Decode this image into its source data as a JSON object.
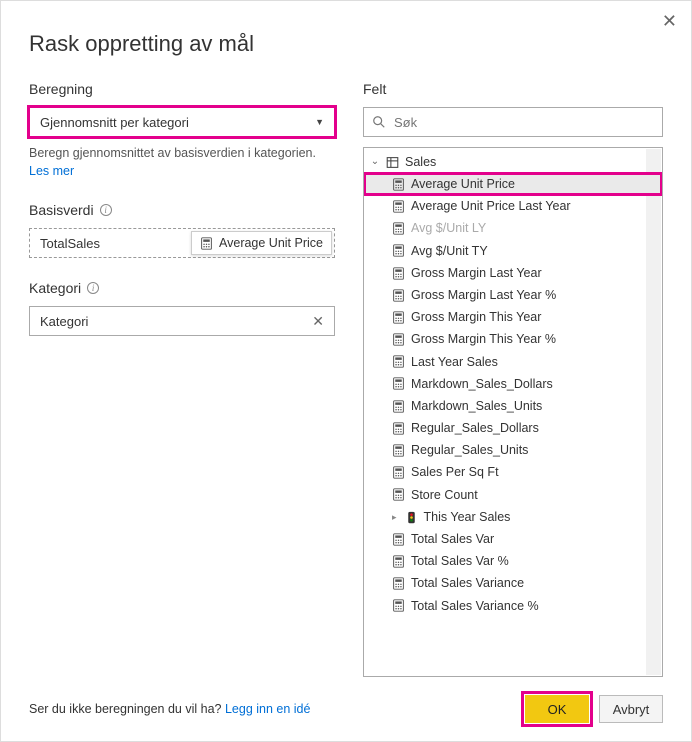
{
  "dialog": {
    "title": "Rask oppretting av mål",
    "close_tooltip": "Lukk"
  },
  "calc": {
    "label": "Beregning",
    "selected": "Gjennomsnitt per kategori",
    "description": "Beregn gjennomsnittet av basisverdien i kategorien.",
    "more_link": "Les mer"
  },
  "base": {
    "label": "Basisverdi",
    "value": "TotalSales",
    "drag_item": "Average Unit Price"
  },
  "category": {
    "label": "Kategori",
    "value": "Kategori"
  },
  "fields": {
    "label": "Felt",
    "search_placeholder": "Søk",
    "table": "Sales",
    "items": [
      {
        "label": "Average Unit Price",
        "selected": true
      },
      {
        "label": "Average Unit Price Last Year"
      },
      {
        "label": "Avg $/Unit LY",
        "dim": true
      },
      {
        "label": "Avg $/Unit TY"
      },
      {
        "label": "Gross Margin Last Year"
      },
      {
        "label": "Gross Margin Last Year %"
      },
      {
        "label": "Gross Margin This Year"
      },
      {
        "label": "Gross Margin This Year %"
      },
      {
        "label": "Last Year Sales"
      },
      {
        "label": "Markdown_Sales_Dollars"
      },
      {
        "label": "Markdown_Sales_Units"
      },
      {
        "label": "Regular_Sales_Dollars"
      },
      {
        "label": "Regular_Sales_Units"
      },
      {
        "label": "Sales Per Sq Ft"
      },
      {
        "label": "Store Count"
      },
      {
        "label": "This Year Sales",
        "kpi": true
      },
      {
        "label": "Total Sales Var"
      },
      {
        "label": "Total Sales Var %"
      },
      {
        "label": "Total Sales Variance"
      },
      {
        "label": "Total Sales Variance %"
      }
    ]
  },
  "footer": {
    "prompt": "Ser du ikke beregningen du vil ha? ",
    "idea_link": "Legg inn en idé",
    "ok": "OK",
    "cancel": "Avbryt"
  }
}
